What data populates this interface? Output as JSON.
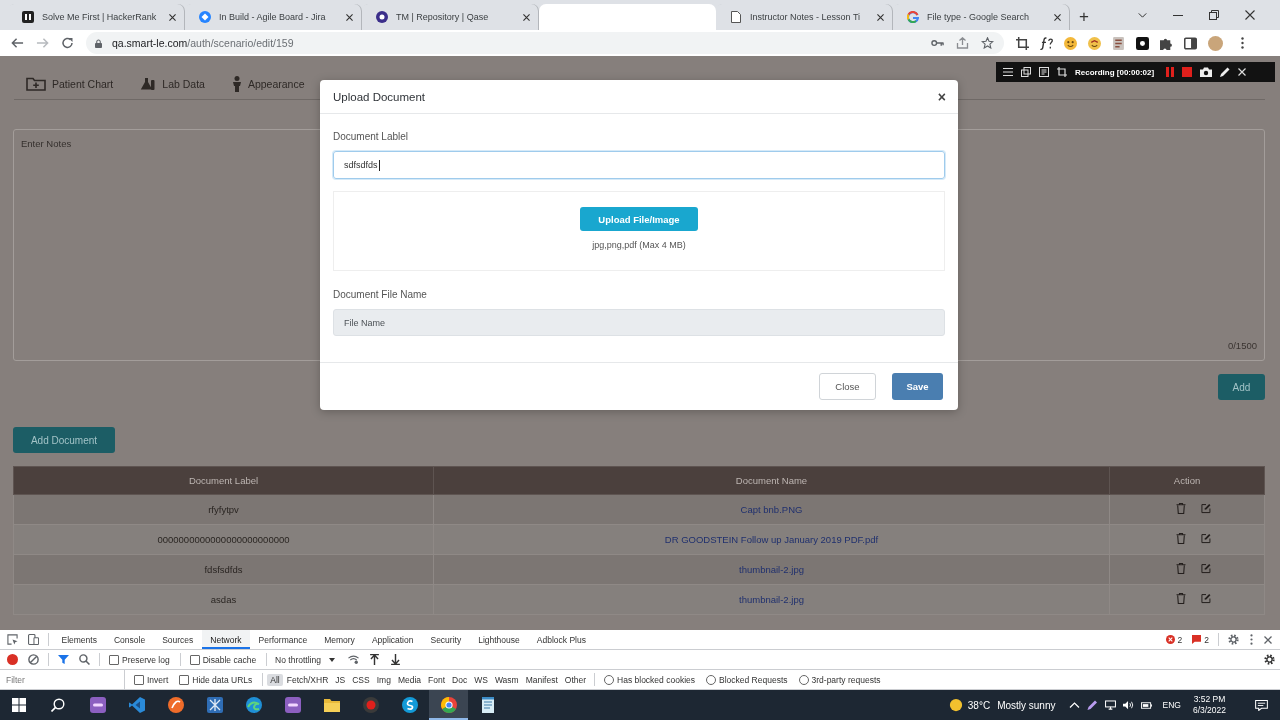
{
  "browser": {
    "tabs": [
      {
        "title": "Solve Me First | HackerRank",
        "selected": false
      },
      {
        "title": "In Build - Agile Board - Jira",
        "selected": false
      },
      {
        "title": "TM | Repository | Qase",
        "selected": false
      },
      {
        "selected": true
      },
      {
        "title": "Instructor Notes - Lesson Ti",
        "selected": false
      },
      {
        "title": "File type - Google Search",
        "selected": false
      }
    ],
    "new_tab": "+",
    "url": {
      "host": "qa.smart-le.com",
      "path": "/auth/scenario/edit/159"
    }
  },
  "recorder": {
    "status": "Recording [00:00:02]"
  },
  "page": {
    "nav": [
      "Patient Chart",
      "Lab Data",
      "Appearance"
    ],
    "notes": {
      "placeholder": "Enter Notes",
      "counter": "0/1500"
    },
    "add_button": "Add",
    "add_document_button": "Add Document",
    "table": {
      "columns": [
        "Document Label",
        "Document Name",
        "Action"
      ],
      "rows": [
        {
          "label": "rfyfytpv",
          "name": "Capt bnb.PNG"
        },
        {
          "label": "0000000000000000000000000",
          "name": "DR GOODSTEIN Follow up January 2019 PDF.pdf"
        },
        {
          "label": "fdsfsdfds",
          "name": "thumbnail-2.jpg"
        },
        {
          "label": "asdas",
          "name": "thumbnail-2.jpg"
        }
      ]
    }
  },
  "modal": {
    "title": "Upload Document",
    "close": "×",
    "label_field": {
      "label": "Document Lablel",
      "value": "sdfsdfds",
      "focused": true
    },
    "upload_button": "Upload File/Image",
    "upload_hint": "jpg,png,pdf (Max 4 MB)",
    "file_field": {
      "label": "Document File Name",
      "placeholder": "File Name",
      "disabled": true
    },
    "buttons": [
      {
        "label": "Close",
        "kind": "secondary"
      },
      {
        "label": "Save",
        "kind": "primary"
      }
    ]
  },
  "devtools": {
    "tabs": [
      {
        "label": "Elements",
        "selected": false
      },
      {
        "label": "Console",
        "selected": false
      },
      {
        "label": "Sources",
        "selected": false
      },
      {
        "label": "Network",
        "selected": true
      },
      {
        "label": "Performance",
        "selected": false
      },
      {
        "label": "Memory",
        "selected": false
      },
      {
        "label": "Application",
        "selected": false
      },
      {
        "label": "Security",
        "selected": false
      },
      {
        "label": "Lighthouse",
        "selected": false
      },
      {
        "label": "Adblock Plus",
        "selected": false
      }
    ],
    "error_count": "2",
    "message_count": "2",
    "options": [
      {
        "label": "Preserve log",
        "checked": false
      },
      {
        "label": "Disable cache",
        "checked": false
      }
    ],
    "throttling": "No throttling",
    "filter": {
      "placeholder": "Filter",
      "options": [
        {
          "label": "Invert",
          "checked": false
        },
        {
          "label": "Hide data URLs",
          "checked": false
        }
      ],
      "types": [
        {
          "label": "All",
          "selected": true
        },
        {
          "label": "Fetch/XHR",
          "selected": false
        },
        {
          "label": "JS",
          "selected": false
        },
        {
          "label": "CSS",
          "selected": false
        },
        {
          "label": "Img",
          "selected": false
        },
        {
          "label": "Media",
          "selected": false
        },
        {
          "label": "Font",
          "selected": false
        },
        {
          "label": "Doc",
          "selected": false
        },
        {
          "label": "WS",
          "selected": false
        },
        {
          "label": "Wasm",
          "selected": false
        },
        {
          "label": "Manifest",
          "selected": false
        },
        {
          "label": "Other",
          "selected": false
        }
      ],
      "more_options": [
        {
          "label": "Has blocked cookies",
          "checked": false
        },
        {
          "label": "Blocked Requests",
          "checked": false
        },
        {
          "label": "3rd-party requests",
          "checked": false
        }
      ]
    }
  },
  "taskbar": {
    "apps": [
      {
        "active": false
      },
      {
        "active": false
      },
      {
        "active": false
      },
      {
        "active": false
      },
      {
        "active": false
      },
      {
        "active": false
      },
      {
        "active": false
      },
      {
        "active": false
      },
      {
        "active": false
      },
      {
        "active": true
      },
      {
        "active": false
      }
    ],
    "weather": {
      "temperature": "38°C",
      "condition": "Mostly sunny"
    },
    "language": "ENG",
    "time": "3:52 PM",
    "date": "6/3/2022"
  }
}
